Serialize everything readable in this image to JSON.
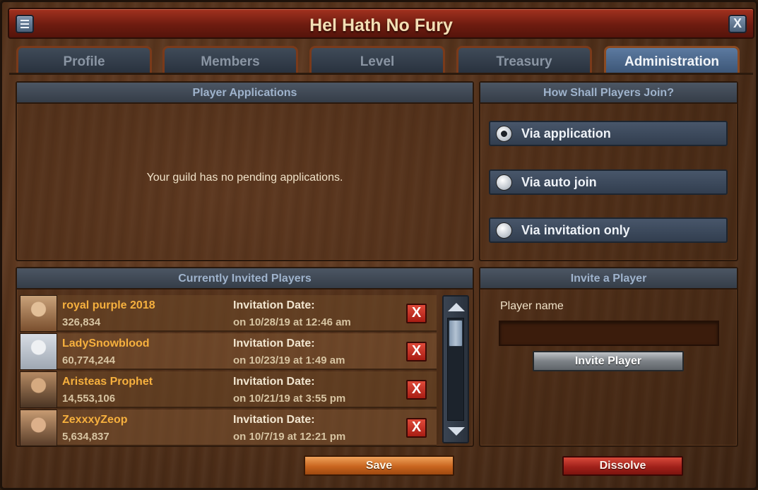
{
  "window": {
    "title": "Hel Hath No Fury",
    "menu_icon": "menu-icon",
    "close_label": "X"
  },
  "tabs": [
    {
      "label": "Profile",
      "active": false
    },
    {
      "label": "Members",
      "active": false
    },
    {
      "label": "Level",
      "active": false
    },
    {
      "label": "Treasury",
      "active": false
    },
    {
      "label": "Administration",
      "active": true
    }
  ],
  "applications": {
    "header": "Player Applications",
    "empty_message": "Your guild has no pending applications."
  },
  "join_mode": {
    "header": "How Shall Players Join?",
    "options": [
      {
        "label": "Via application",
        "selected": true
      },
      {
        "label": "Via auto join",
        "selected": false
      },
      {
        "label": "Via invitation only",
        "selected": false
      }
    ]
  },
  "invited": {
    "header": "Currently Invited Players",
    "date_label": "Invitation Date:",
    "remove_label": "X",
    "players": [
      {
        "name": "royal purple 2018",
        "score": "326,834",
        "date": "on 10/28/19 at 12:46 am",
        "avatar_colors": [
          "#c9a27a",
          "#7a4f2e"
        ]
      },
      {
        "name": "LadySnowblood",
        "score": "60,774,244",
        "date": "on 10/23/19 at 1:49 am",
        "avatar_colors": [
          "#d8dde4",
          "#9ea7b3"
        ]
      },
      {
        "name": "Aristeas Prophet",
        "score": "14,553,106",
        "date": "on 10/21/19 at 3:55 pm",
        "avatar_colors": [
          "#b58a63",
          "#4b3524"
        ]
      },
      {
        "name": "ZexxxyZeop",
        "score": "5,634,837",
        "date": "on 10/7/19 at 12:21 pm",
        "avatar_colors": [
          "#c79b72",
          "#5a3e2a"
        ]
      }
    ]
  },
  "invite": {
    "header": "Invite a Player",
    "field_label": "Player name",
    "field_value": "",
    "button_label": "Invite Player"
  },
  "footer": {
    "save_label": "Save",
    "dissolve_label": "Dissolve"
  }
}
